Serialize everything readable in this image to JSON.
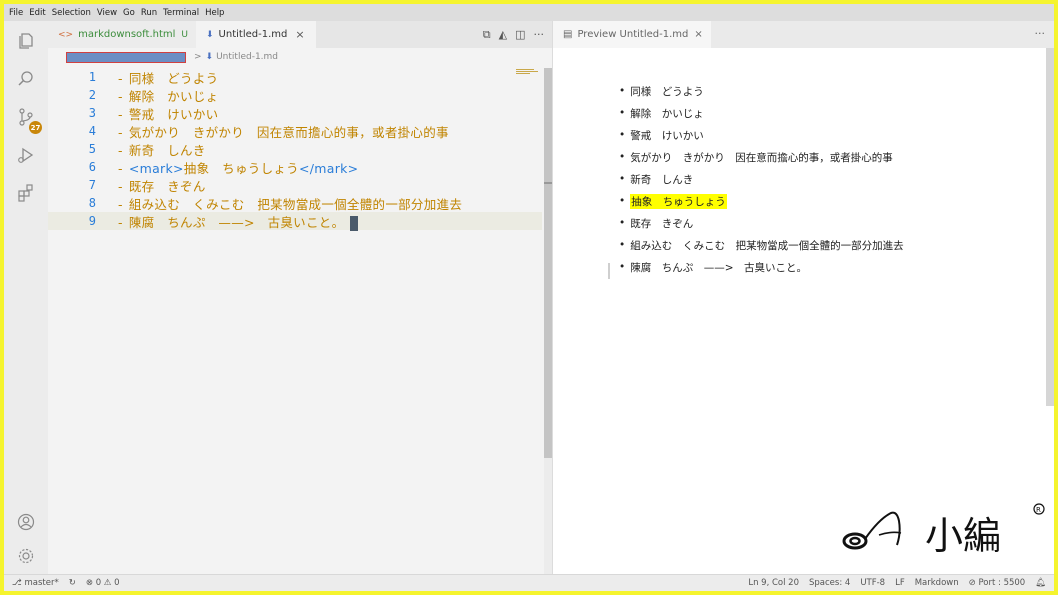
{
  "menu": [
    "File",
    "Edit",
    "Selection",
    "View",
    "Go",
    "Run",
    "Terminal",
    "Help"
  ],
  "activity": {
    "scm_badge": "27"
  },
  "left_tabs": {
    "html_tab": "markdownsoft.html",
    "html_badge": "U",
    "md_tab": "Untitled-1.md",
    "close": "×"
  },
  "editor_actions": [
    "⧉",
    "◭",
    "◫",
    "···"
  ],
  "breadcrumb": {
    "separator": ">",
    "file": "Untitled-1.md"
  },
  "code_lines": [
    {
      "no": "1",
      "text": "同様　どうよう"
    },
    {
      "no": "2",
      "text": "解除　かいじょ"
    },
    {
      "no": "3",
      "text": "警戒　けいかい"
    },
    {
      "no": "4",
      "text": "気がかり　きがかり　因在意而擔心的事，或者掛心的事"
    },
    {
      "no": "5",
      "text": "新奇　しんき"
    },
    {
      "no": "6",
      "tag_open": "<mark>",
      "text": "抽象　ちゅうしょう",
      "tag_close": "</mark>"
    },
    {
      "no": "7",
      "text": "既存　きぞん"
    },
    {
      "no": "8",
      "text": "組み込む　くみこむ　把某物當成一個全體的一部分加進去"
    },
    {
      "no": "9",
      "text": "陳腐　ちんぷ　——>　古臭いこと。"
    }
  ],
  "preview_tab": {
    "label": "Preview Untitled-1.md",
    "close": "×",
    "more": "···"
  },
  "preview_items": [
    "同様　どうよう",
    "解除　かいじょ",
    "警戒　けいかい",
    "気がかり　きがかり　因在意而擔心的事，或者掛心的事",
    "新奇　しんき",
    "抽象　ちゅうしょう",
    "既存　きぞん",
    "組み込む　くみこむ　把某物當成一個全體的一部分加進去",
    "陳腐　ちんぷ　——>　古臭いこと。"
  ],
  "status": {
    "branch": "master*",
    "errors": "0",
    "warnings": "0",
    "position": "Ln 9, Col 20",
    "spaces": "Spaces: 4",
    "encoding": "UTF-8",
    "eol": "LF",
    "language": "Markdown",
    "port": "Port : 5500"
  },
  "watermark": {
    "text": "小編"
  },
  "colors": {
    "frame": "#f5f42e",
    "markdown_text": "#c08400",
    "line_number": "#2a7dd8",
    "highlight": "#ffff00"
  }
}
